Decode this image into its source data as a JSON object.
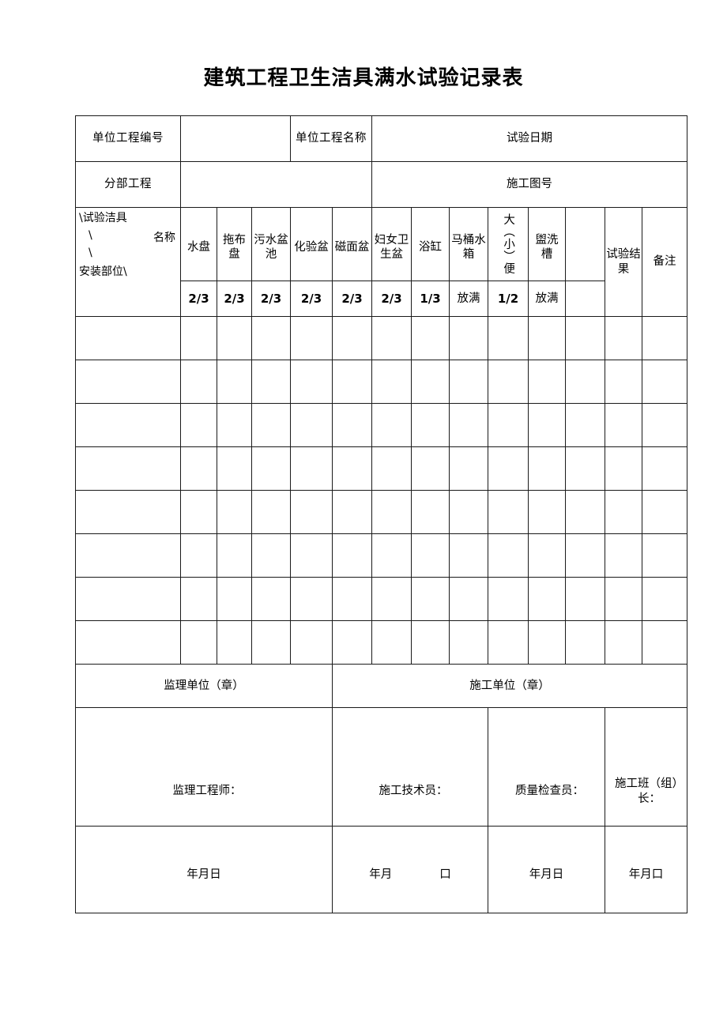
{
  "document": {
    "title": "建筑工程卫生洁具满水试验记录表"
  },
  "info_rows": {
    "unit_project_no_label": "单位工程编号",
    "unit_project_no_value": "",
    "unit_project_name_label": "单位工程名称",
    "test_date_label": "试验日期",
    "sub_project_label": "分部工程",
    "sub_project_value": "",
    "drawing_no_label": "施工图号"
  },
  "corner_header": {
    "line1": "\\试验洁具",
    "line2_slash": "\\",
    "line2_text": "名称",
    "line3_slash": "\\",
    "line4": "安装部位\\"
  },
  "fixtures": [
    {
      "name": "水盘",
      "value": "2/3",
      "vertical": false
    },
    {
      "name": "拖布盘",
      "value": "2/3",
      "vertical": false
    },
    {
      "name": "污水盆池",
      "value": "2/3",
      "vertical": false
    },
    {
      "name": "化验盆",
      "value": "2/3",
      "vertical": false
    },
    {
      "name": "磁面盆",
      "value": "2/3",
      "vertical": false
    },
    {
      "name": "妇女卫生盆",
      "value": "2/3",
      "vertical": false
    },
    {
      "name": "浴缸",
      "value": "1/3",
      "vertical": false
    },
    {
      "name": "马桶水箱",
      "value": "放满",
      "vertical": false
    },
    {
      "name": "大（小）便",
      "value": "1/2",
      "vertical": true
    },
    {
      "name": "盥洗槽",
      "value": "放满",
      "vertical": false
    },
    {
      "name": "",
      "value": "",
      "vertical": false
    }
  ],
  "result_columns": {
    "test_result": "试验结果",
    "remarks": "备注"
  },
  "data_rows": [
    {
      "cells": [
        "",
        "",
        "",
        "",
        "",
        "",
        "",
        "",
        "",
        "",
        "",
        "",
        ""
      ]
    },
    {
      "cells": [
        "",
        "",
        "",
        "",
        "",
        "",
        "",
        "",
        "",
        "",
        "",
        "",
        ""
      ]
    },
    {
      "cells": [
        "",
        "",
        "",
        "",
        "",
        "",
        "",
        "",
        "",
        "",
        "",
        "",
        ""
      ]
    },
    {
      "cells": [
        "",
        "",
        "",
        "",
        "",
        "",
        "",
        "",
        "",
        "",
        "",
        "",
        ""
      ]
    },
    {
      "cells": [
        "",
        "",
        "",
        "",
        "",
        "",
        "",
        "",
        "",
        "",
        "",
        "",
        ""
      ]
    },
    {
      "cells": [
        "",
        "",
        "",
        "",
        "",
        "",
        "",
        "",
        "",
        "",
        "",
        "",
        ""
      ]
    },
    {
      "cells": [
        "",
        "",
        "",
        "",
        "",
        "",
        "",
        "",
        "",
        "",
        "",
        "",
        ""
      ]
    },
    {
      "cells": [
        "",
        "",
        "",
        "",
        "",
        "",
        "",
        "",
        "",
        "",
        "",
        "",
        ""
      ]
    }
  ],
  "signature": {
    "supervisor_unit_label": "监理单位（章）",
    "construction_unit_label": "施工单位（章）",
    "roles": [
      {
        "label": "监理工程师：",
        "date": "年月日",
        "date_split": false
      },
      {
        "label": "施工技术员：",
        "date_part1": "年月",
        "date_part2": "口",
        "date_split": true
      },
      {
        "label": "质量检查员：",
        "date": "年月日",
        "date_split": false
      },
      {
        "label": "施工班（组）长：",
        "date": "年月口",
        "date_split": false
      }
    ]
  }
}
